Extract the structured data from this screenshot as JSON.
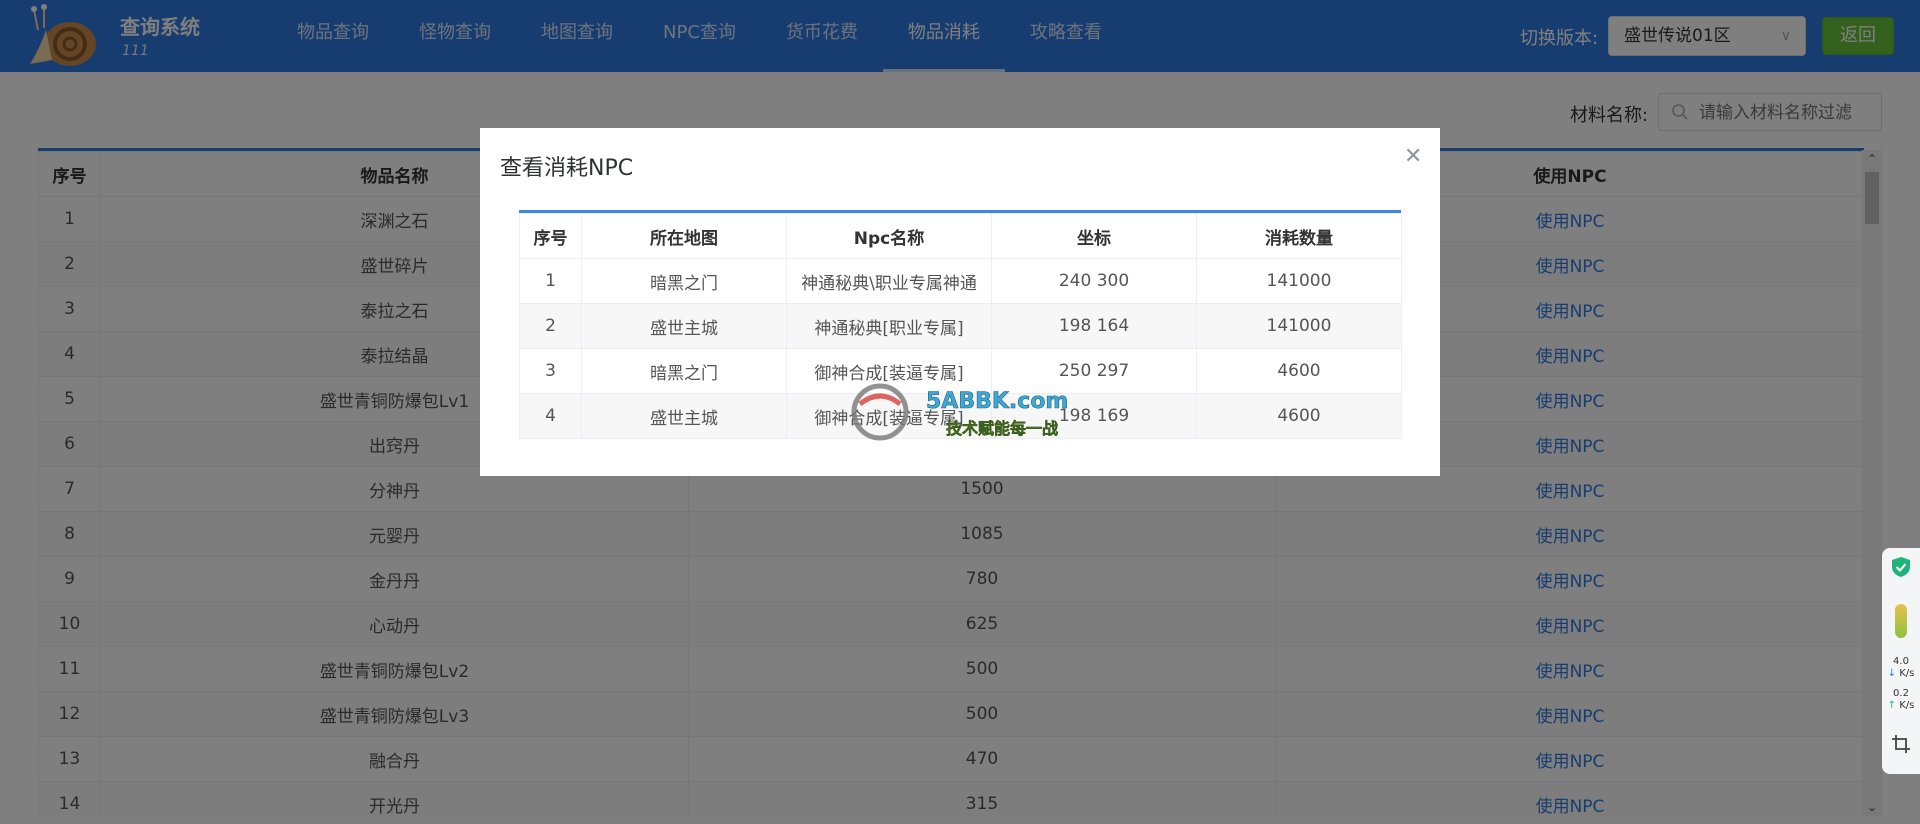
{
  "header": {
    "title": "查询系统",
    "subtitle": "111",
    "nav": [
      "物品查询",
      "怪物查询",
      "地图查询",
      "NPC查询",
      "货币花费",
      "物品消耗",
      "攻略查看"
    ],
    "active_nav": "物品消耗",
    "version_label": "切换版本:",
    "version_value": "盛世传说01区",
    "back_label": "返回"
  },
  "filter": {
    "label": "材料名称:",
    "placeholder": "请输入材料名称过滤"
  },
  "main_table": {
    "columns": [
      "序号",
      "物品名称",
      "",
      "使用NPC"
    ],
    "rows": [
      {
        "no": "1",
        "name": "深渊之石",
        "count": "",
        "npc": "使用NPC"
      },
      {
        "no": "2",
        "name": "盛世碎片",
        "count": "",
        "npc": "使用NPC"
      },
      {
        "no": "3",
        "name": "泰拉之石",
        "count": "",
        "npc": "使用NPC"
      },
      {
        "no": "4",
        "name": "泰拉结晶",
        "count": "",
        "npc": "使用NPC"
      },
      {
        "no": "5",
        "name": "盛世青铜防爆包Lv1",
        "count": "",
        "npc": "使用NPC"
      },
      {
        "no": "6",
        "name": "出窍丹",
        "count": "",
        "npc": "使用NPC"
      },
      {
        "no": "7",
        "name": "分神丹",
        "count": "1500",
        "npc": "使用NPC"
      },
      {
        "no": "8",
        "name": "元婴丹",
        "count": "1085",
        "npc": "使用NPC"
      },
      {
        "no": "9",
        "name": "金丹丹",
        "count": "780",
        "npc": "使用NPC"
      },
      {
        "no": "10",
        "name": "心动丹",
        "count": "625",
        "npc": "使用NPC"
      },
      {
        "no": "11",
        "name": "盛世青铜防爆包Lv2",
        "count": "500",
        "npc": "使用NPC"
      },
      {
        "no": "12",
        "name": "盛世青铜防爆包Lv3",
        "count": "500",
        "npc": "使用NPC"
      },
      {
        "no": "13",
        "name": "融合丹",
        "count": "470",
        "npc": "使用NPC"
      },
      {
        "no": "14",
        "name": "开光丹",
        "count": "315",
        "npc": "使用NPC"
      }
    ]
  },
  "dialog": {
    "title": "查看消耗NPC",
    "columns": [
      "序号",
      "所在地图",
      "Npc名称",
      "坐标",
      "消耗数量"
    ],
    "rows": [
      {
        "no": "1",
        "map": "暗黑之门",
        "npc": "神通秘典\\职业专属神通",
        "coord": "240 300",
        "qty": "141000"
      },
      {
        "no": "2",
        "map": "盛世主城",
        "npc": "神通秘典[职业专属]",
        "coord": "198 164",
        "qty": "141000"
      },
      {
        "no": "3",
        "map": "暗黑之门",
        "npc": "御神合成[装逼专属]",
        "coord": "250 297",
        "qty": "4600"
      },
      {
        "no": "4",
        "map": "盛世主城",
        "npc": "御神合成[装逼专属]",
        "coord": "198 169",
        "qty": "4600"
      }
    ]
  },
  "side_widget": {
    "down_speed": "4.0",
    "down_unit": "K/s",
    "up_speed": "0.2",
    "up_unit": "K/s"
  },
  "watermark": {
    "site": "5ABBK.com",
    "slogan": "技术赋能每一战"
  },
  "colors": {
    "header": "#2e7be0",
    "link": "#2e7be0",
    "back_button": "#67c23a"
  }
}
